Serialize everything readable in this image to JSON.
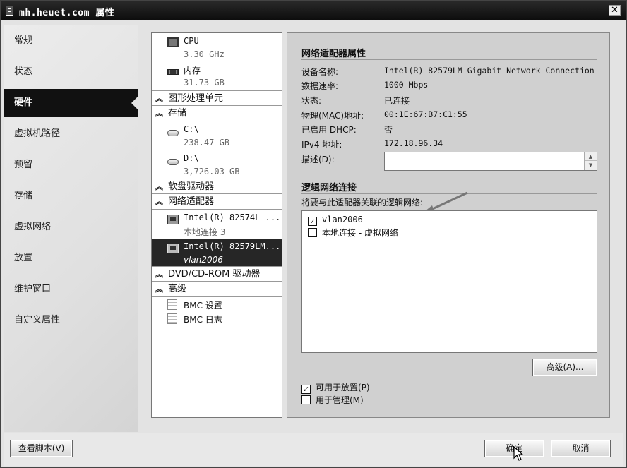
{
  "window": {
    "title": "mh.heuet.com 属性"
  },
  "nav": {
    "items": [
      {
        "label": "常规",
        "active": false
      },
      {
        "label": "状态",
        "active": false
      },
      {
        "label": "硬件",
        "active": true
      },
      {
        "label": "虚拟机路径",
        "active": false
      },
      {
        "label": "预留",
        "active": false
      },
      {
        "label": "存储",
        "active": false
      },
      {
        "label": "虚拟网络",
        "active": false
      },
      {
        "label": "放置",
        "active": false
      },
      {
        "label": "维护窗口",
        "active": false
      },
      {
        "label": "自定义属性",
        "active": false
      }
    ]
  },
  "tree": {
    "cpu": {
      "name": "CPU",
      "value": "3.30 GHz"
    },
    "memory": {
      "name": "内存",
      "value": "31.73 GB"
    },
    "gpu_header": "图形处理单元",
    "storage_header": "存储",
    "disk_c": {
      "name": "C:\\",
      "value": "238.47 GB"
    },
    "disk_d": {
      "name": "D:\\",
      "value": "3,726.03 GB"
    },
    "floppy_header": "软盘驱动器",
    "nic_header": "网络适配器",
    "nic1": {
      "name": "Intel(R) 82574L ...",
      "sub": "本地连接 3"
    },
    "nic2": {
      "name": "Intel(R) 82579LM...",
      "sub": "vlan2006"
    },
    "dvd_header": "DVD/CD-ROM 驱动器",
    "advanced_header": "高级",
    "bmc_settings": "BMC 设置",
    "bmc_log": "BMC 日志"
  },
  "props": {
    "title": "网络适配器属性",
    "fields": [
      {
        "label": "设备名称:",
        "value": "Intel(R) 82579LM Gigabit Network Connection"
      },
      {
        "label": "数据速率:",
        "value": "1000 Mbps"
      },
      {
        "label": "状态:",
        "value": "已连接"
      },
      {
        "label": "物理(MAC)地址:",
        "value": "00:1E:67:B7:C1:55"
      },
      {
        "label": "已启用 DHCP:",
        "value": "否"
      },
      {
        "label": "IPv4 地址:",
        "value": "172.18.96.34"
      }
    ],
    "desc_label": "描述(D):",
    "desc_value": "",
    "ln_title": "逻辑网络连接",
    "ln_prompt": "将要与此适配器关联的逻辑网络:",
    "ln_items": [
      {
        "label": "vlan2006",
        "checked": true
      },
      {
        "label": "本地连接 - 虚拟网络",
        "checked": false
      }
    ],
    "advanced_button": "高级(A)...",
    "placement_label": "可用于放置(P)",
    "placement_checked": true,
    "management_label": "用于管理(M)",
    "management_checked": false
  },
  "footer": {
    "view_script": "查看脚本(V)",
    "ok": "确定",
    "cancel": "取消"
  },
  "colors": {
    "selection": "#262626",
    "panel": "#d0d0d0",
    "arrow": "#777777"
  }
}
